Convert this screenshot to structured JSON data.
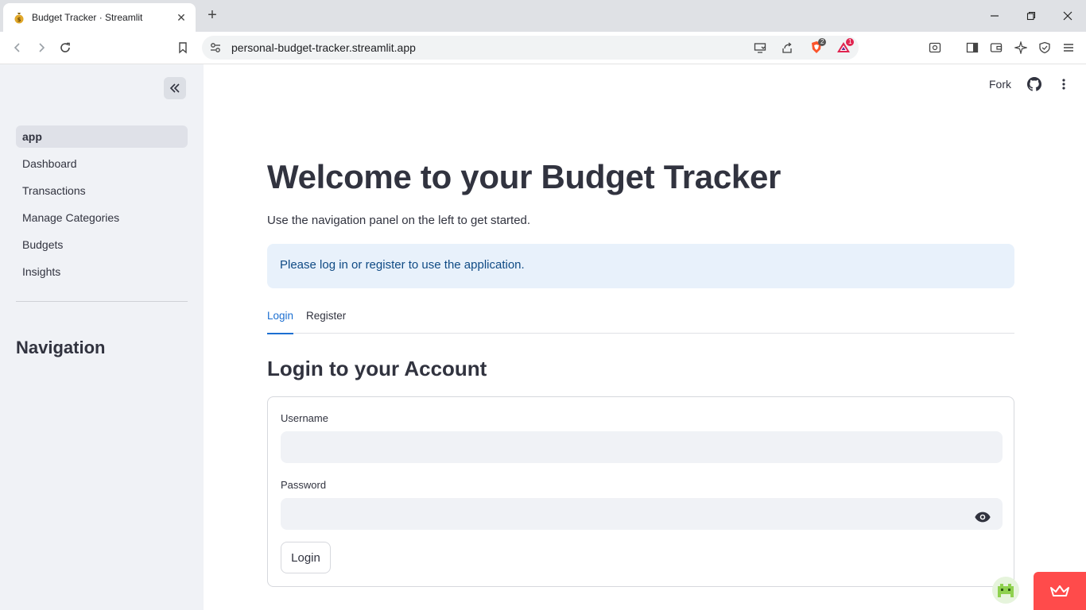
{
  "browser": {
    "tab_title": "Budget Tracker · Streamlit",
    "url": "personal-budget-tracker.streamlit.app",
    "brave_badge": "2",
    "rewards_badge": "1"
  },
  "sidebar": {
    "items": [
      {
        "label": "app",
        "active": true
      },
      {
        "label": "Dashboard"
      },
      {
        "label": "Transactions"
      },
      {
        "label": "Manage Categories"
      },
      {
        "label": "Budgets"
      },
      {
        "label": "Insights"
      }
    ],
    "heading": "Navigation"
  },
  "header": {
    "fork_label": "Fork"
  },
  "main": {
    "title": "Welcome to your Budget Tracker",
    "subtitle": "Use the navigation panel on the left to get started.",
    "info_message": "Please log in or register to use the application.",
    "tabs": [
      {
        "label": "Login",
        "active": true
      },
      {
        "label": "Register"
      }
    ],
    "section_title": "Login to your Account",
    "form": {
      "username_label": "Username",
      "username_value": "",
      "password_label": "Password",
      "password_value": "",
      "submit_label": "Login"
    }
  },
  "colors": {
    "accent": "#1c6fd1",
    "info_bg": "#e8f1fb",
    "sidebar_bg": "#f0f2f6",
    "streamlit_red": "#ff4b4b"
  }
}
